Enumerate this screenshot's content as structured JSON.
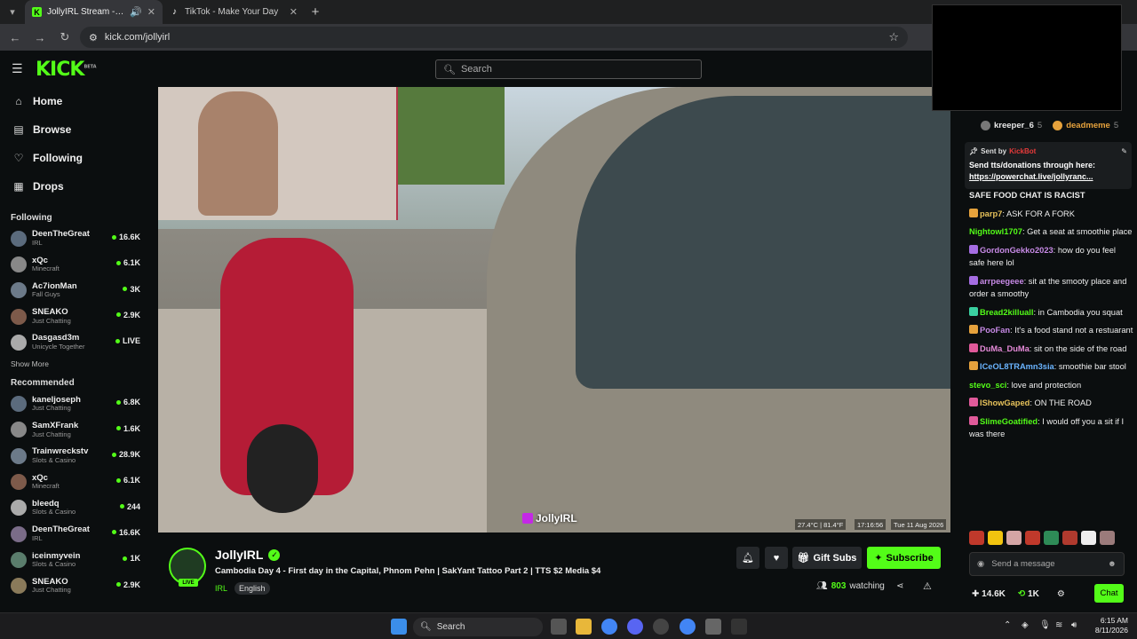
{
  "browser": {
    "tabs": [
      {
        "title": "JollyIRL Stream - Watch Live",
        "favicon": "kick-icon",
        "active": true
      },
      {
        "title": "TikTok - Make Your Day",
        "favicon": "tiktok-icon",
        "active": false
      }
    ],
    "url": "kick.com/jollyirl"
  },
  "header": {
    "logo": "KICK",
    "logo_badge": "BETA",
    "search_placeholder": "Search"
  },
  "sidebar": {
    "nav": [
      {
        "label": "Home",
        "icon": "home-icon"
      },
      {
        "label": "Browse",
        "icon": "browse-icon"
      },
      {
        "label": "Following",
        "icon": "heart-icon"
      },
      {
        "label": "Drops",
        "icon": "drops-icon"
      }
    ],
    "following_title": "Following",
    "following": [
      {
        "name": "DeenTheGreat",
        "category": "IRL",
        "viewers": "16.6K"
      },
      {
        "name": "xQc",
        "category": "Minecraft",
        "viewers": "6.1K"
      },
      {
        "name": "Ac7ionMan",
        "category": "Fall Guys",
        "viewers": "3K"
      },
      {
        "name": "SNEAKO",
        "category": "Just Chatting",
        "viewers": "2.9K"
      },
      {
        "name": "Dasgasd3m",
        "category": "Unicycle Together",
        "viewers": "LIVE"
      }
    ],
    "show_more": "Show More",
    "recommended_title": "Recommended",
    "recommended": [
      {
        "name": "kaneljoseph",
        "category": "Just Chatting",
        "viewers": "6.8K"
      },
      {
        "name": "SamXFrank",
        "category": "Just Chatting",
        "viewers": "1.6K"
      },
      {
        "name": "Trainwreckstv",
        "category": "Slots & Casino",
        "viewers": "28.9K"
      },
      {
        "name": "xQc",
        "category": "Minecraft",
        "viewers": "6.1K"
      },
      {
        "name": "bleedq",
        "category": "Slots & Casino",
        "viewers": "244"
      },
      {
        "name": "DeenTheGreat",
        "category": "IRL",
        "viewers": "16.6K"
      },
      {
        "name": "iceinmyvein",
        "category": "Slots & Casino",
        "viewers": "1K"
      },
      {
        "name": "SNEAKO",
        "category": "Just Chatting",
        "viewers": "2.9K"
      }
    ]
  },
  "video": {
    "watermark": "JollyIRL",
    "hud": [
      "27.4°C | 81.4°F",
      "17:16:56",
      "Tue 11 Aug 2026"
    ]
  },
  "stream": {
    "streamer": "JollyIRL",
    "live_badge": "LIVE",
    "title": "Cambodia Day 4 - First day in the Capital, Phnom Pehn | SakYant Tattoo Part 2 | TTS $2 Media $4",
    "category": "IRL",
    "tag": "English",
    "gift_label": "Gift Subs",
    "subscribe_label": "Subscribe",
    "viewers": "803",
    "watching_label": "watching"
  },
  "chat": {
    "gifters": [
      {
        "name": "kreeper_6",
        "count": "5",
        "color": "#888888"
      },
      {
        "name": "deadmeme",
        "count": "5",
        "color": "#e6a23c"
      }
    ],
    "pinned": {
      "sent_by": "Sent by",
      "bot_name": "KickBot",
      "message": "Send tts/donations through here:",
      "link": "https://powerchat.live/jollyranc..."
    },
    "messages": [
      {
        "user": "",
        "user_color": "#ffffff",
        "text": "SAFE FOOD CHAT IS RACIST"
      },
      {
        "user": "parp7",
        "user_color": "#e6c15a",
        "text": "ASK FOR A FORK"
      },
      {
        "user": "Nightowl1707",
        "user_color": "#53fc18",
        "text": "Get a seat at smoothie place"
      },
      {
        "user": "GordonGekko2023",
        "user_color": "#c78ae6",
        "text": "how do you feel safe here lol"
      },
      {
        "user": "arrpeegeee",
        "user_color": "#c78ae6",
        "text": "sit at the smooty place and order a smoothy"
      },
      {
        "user": "Bread2killuall",
        "user_color": "#53fc18",
        "text": "in Cambodia you squat"
      },
      {
        "user": "PooFan",
        "user_color": "#c78ae6",
        "text": "It's a food stand not a restuarant"
      },
      {
        "user": "DuMa_DuMa",
        "user_color": "#e58ad8",
        "text": "sit on the side of the road"
      },
      {
        "user": "ICeOL8TRAmn3sia",
        "user_color": "#6ab4ff",
        "text": "smoothie bar stool"
      },
      {
        "user": "stevo_sci",
        "user_color": "#53fc18",
        "text": "love and protection"
      },
      {
        "user": "IShowGaped",
        "user_color": "#e6c15a",
        "text": "ON THE ROAD"
      },
      {
        "user": "SlimeGoatified",
        "user_color": "#53fc18",
        "text": "I would off you a sit if I was there"
      }
    ],
    "input_placeholder": "Send a message",
    "footer_left": "14.6K",
    "footer_mid": "1K",
    "chat_button": "Chat"
  },
  "taskbar": {
    "search": "Search",
    "time": "6:15 AM",
    "date": "8/11/2026"
  }
}
